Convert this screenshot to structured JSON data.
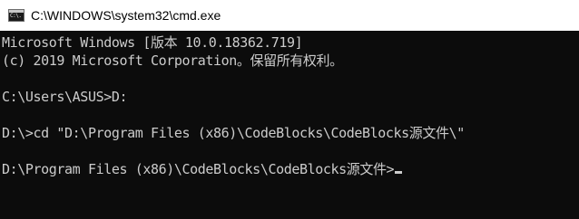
{
  "window": {
    "title": "C:\\WINDOWS\\system32\\cmd.exe",
    "icon": "cmd-prompt-icon",
    "icon_text": "C:\\."
  },
  "console": {
    "lines": [
      "Microsoft Windows [版本 10.0.18362.719]",
      "(c) 2019 Microsoft Corporation。保留所有权利。",
      "C:\\Users\\ASUS>D:",
      "D:\\>cd \"D:\\Program Files (x86)\\CodeBlocks\\CodeBlocks源文件\\\"",
      "D:\\Program Files (x86)\\CodeBlocks\\CodeBlocks源文件>"
    ]
  },
  "colors": {
    "console_bg": "#0c0c0c",
    "console_fg": "#cccccc",
    "titlebar_bg": "#ffffff"
  }
}
